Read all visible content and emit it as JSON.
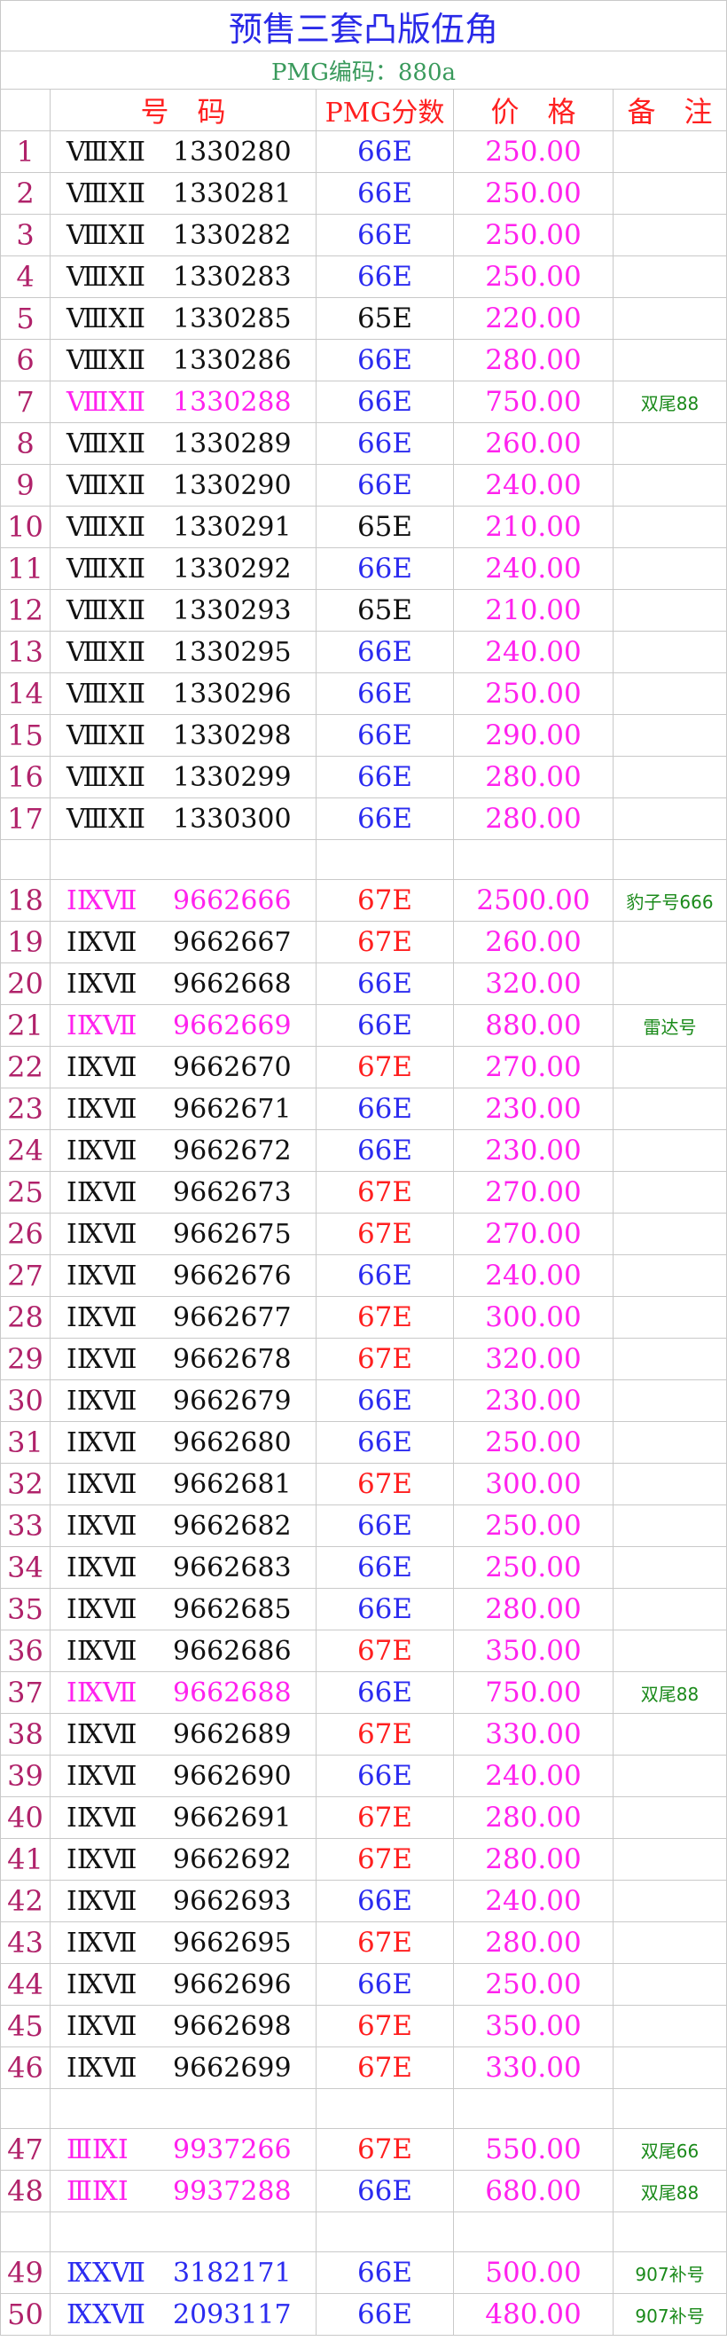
{
  "title": "预售三套凸版伍角",
  "subtitle": "PMG编码：880a",
  "headers": {
    "code": "号　码",
    "grade": "PMG分数",
    "price": "价　格",
    "note": "备　注"
  },
  "colors": {
    "title": "#2a2ae8",
    "subtitle": "#3a9a5c",
    "header": "#ff2020",
    "grade_66": "#2b2bf0",
    "grade_67": "#ff1f1f",
    "grade_65": "#111111",
    "price": "#ff22ee",
    "note": "#1a8a1a",
    "row_number": "#b0226a"
  },
  "rows": [
    {
      "type": "item",
      "no": "1",
      "serial": "ⅧⅩⅡ",
      "number": "1330280",
      "grade": "66E",
      "grade_color": "blue",
      "price": "250.00",
      "note": ""
    },
    {
      "type": "item",
      "no": "2",
      "serial": "ⅧⅩⅡ",
      "number": "1330281",
      "grade": "66E",
      "grade_color": "blue",
      "price": "250.00",
      "note": ""
    },
    {
      "type": "item",
      "no": "3",
      "serial": "ⅧⅩⅡ",
      "number": "1330282",
      "grade": "66E",
      "grade_color": "blue",
      "price": "250.00",
      "note": ""
    },
    {
      "type": "item",
      "no": "4",
      "serial": "ⅧⅩⅡ",
      "number": "1330283",
      "grade": "66E",
      "grade_color": "blue",
      "price": "250.00",
      "note": ""
    },
    {
      "type": "item",
      "no": "5",
      "serial": "ⅧⅩⅡ",
      "number": "1330285",
      "grade": "65E",
      "grade_color": "black",
      "price": "220.00",
      "note": ""
    },
    {
      "type": "item",
      "no": "6",
      "serial": "ⅧⅩⅡ",
      "number": "1330286",
      "grade": "66E",
      "grade_color": "blue",
      "price": "280.00",
      "note": ""
    },
    {
      "type": "item",
      "no": "7",
      "serial": "ⅧⅩⅡ",
      "number": "1330288",
      "grade": "66E",
      "grade_color": "blue",
      "price": "750.00",
      "note": "双尾88",
      "highlight": true
    },
    {
      "type": "item",
      "no": "8",
      "serial": "ⅧⅩⅡ",
      "number": "1330289",
      "grade": "66E",
      "grade_color": "blue",
      "price": "260.00",
      "note": ""
    },
    {
      "type": "item",
      "no": "9",
      "serial": "ⅧⅩⅡ",
      "number": "1330290",
      "grade": "66E",
      "grade_color": "blue",
      "price": "240.00",
      "note": ""
    },
    {
      "type": "item",
      "no": "10",
      "serial": "ⅧⅩⅡ",
      "number": "1330291",
      "grade": "65E",
      "grade_color": "black",
      "price": "210.00",
      "note": ""
    },
    {
      "type": "item",
      "no": "11",
      "serial": "ⅧⅩⅡ",
      "number": "1330292",
      "grade": "66E",
      "grade_color": "blue",
      "price": "240.00",
      "note": ""
    },
    {
      "type": "item",
      "no": "12",
      "serial": "ⅧⅩⅡ",
      "number": "1330293",
      "grade": "65E",
      "grade_color": "black",
      "price": "210.00",
      "note": ""
    },
    {
      "type": "item",
      "no": "13",
      "serial": "ⅧⅩⅡ",
      "number": "1330295",
      "grade": "66E",
      "grade_color": "blue",
      "price": "240.00",
      "note": ""
    },
    {
      "type": "item",
      "no": "14",
      "serial": "ⅧⅩⅡ",
      "number": "1330296",
      "grade": "66E",
      "grade_color": "blue",
      "price": "250.00",
      "note": ""
    },
    {
      "type": "item",
      "no": "15",
      "serial": "ⅧⅩⅡ",
      "number": "1330298",
      "grade": "66E",
      "grade_color": "blue",
      "price": "290.00",
      "note": ""
    },
    {
      "type": "item",
      "no": "16",
      "serial": "ⅧⅩⅡ",
      "number": "1330299",
      "grade": "66E",
      "grade_color": "blue",
      "price": "280.00",
      "note": ""
    },
    {
      "type": "item",
      "no": "17",
      "serial": "ⅧⅩⅡ",
      "number": "1330300",
      "grade": "66E",
      "grade_color": "blue",
      "price": "280.00",
      "note": ""
    },
    {
      "type": "blank"
    },
    {
      "type": "item",
      "no": "18",
      "serial": "ⅠⅨⅦ",
      "number": "9662666",
      "grade": "67E",
      "grade_color": "red",
      "price": "2500.00",
      "note": "豹子号666",
      "highlight": true
    },
    {
      "type": "item",
      "no": "19",
      "serial": "ⅠⅨⅦ",
      "number": "9662667",
      "grade": "67E",
      "grade_color": "red",
      "price": "260.00",
      "note": ""
    },
    {
      "type": "item",
      "no": "20",
      "serial": "ⅠⅨⅦ",
      "number": "9662668",
      "grade": "66E",
      "grade_color": "blue",
      "price": "320.00",
      "note": ""
    },
    {
      "type": "item",
      "no": "21",
      "serial": "ⅠⅨⅦ",
      "number": "9662669",
      "grade": "66E",
      "grade_color": "blue",
      "price": "880.00",
      "note": "雷达号",
      "highlight": true
    },
    {
      "type": "item",
      "no": "22",
      "serial": "ⅠⅨⅦ",
      "number": "9662670",
      "grade": "67E",
      "grade_color": "red",
      "price": "270.00",
      "note": ""
    },
    {
      "type": "item",
      "no": "23",
      "serial": "ⅠⅨⅦ",
      "number": "9662671",
      "grade": "66E",
      "grade_color": "blue",
      "price": "230.00",
      "note": ""
    },
    {
      "type": "item",
      "no": "24",
      "serial": "ⅠⅨⅦ",
      "number": "9662672",
      "grade": "66E",
      "grade_color": "blue",
      "price": "230.00",
      "note": ""
    },
    {
      "type": "item",
      "no": "25",
      "serial": "ⅠⅨⅦ",
      "number": "9662673",
      "grade": "67E",
      "grade_color": "red",
      "price": "270.00",
      "note": ""
    },
    {
      "type": "item",
      "no": "26",
      "serial": "ⅠⅨⅦ",
      "number": "9662675",
      "grade": "67E",
      "grade_color": "red",
      "price": "270.00",
      "note": ""
    },
    {
      "type": "item",
      "no": "27",
      "serial": "ⅠⅨⅦ",
      "number": "9662676",
      "grade": "66E",
      "grade_color": "blue",
      "price": "240.00",
      "note": ""
    },
    {
      "type": "item",
      "no": "28",
      "serial": "ⅠⅨⅦ",
      "number": "9662677",
      "grade": "67E",
      "grade_color": "red",
      "price": "300.00",
      "note": ""
    },
    {
      "type": "item",
      "no": "29",
      "serial": "ⅠⅨⅦ",
      "number": "9662678",
      "grade": "67E",
      "grade_color": "red",
      "price": "320.00",
      "note": ""
    },
    {
      "type": "item",
      "no": "30",
      "serial": "ⅠⅨⅦ",
      "number": "9662679",
      "grade": "66E",
      "grade_color": "blue",
      "price": "230.00",
      "note": ""
    },
    {
      "type": "item",
      "no": "31",
      "serial": "ⅠⅨⅦ",
      "number": "9662680",
      "grade": "66E",
      "grade_color": "blue",
      "price": "250.00",
      "note": ""
    },
    {
      "type": "item",
      "no": "32",
      "serial": "ⅠⅨⅦ",
      "number": "9662681",
      "grade": "67E",
      "grade_color": "red",
      "price": "300.00",
      "note": ""
    },
    {
      "type": "item",
      "no": "33",
      "serial": "ⅠⅨⅦ",
      "number": "9662682",
      "grade": "66E",
      "grade_color": "blue",
      "price": "250.00",
      "note": ""
    },
    {
      "type": "item",
      "no": "34",
      "serial": "ⅠⅨⅦ",
      "number": "9662683",
      "grade": "66E",
      "grade_color": "blue",
      "price": "250.00",
      "note": ""
    },
    {
      "type": "item",
      "no": "35",
      "serial": "ⅠⅨⅦ",
      "number": "9662685",
      "grade": "66E",
      "grade_color": "blue",
      "price": "280.00",
      "note": ""
    },
    {
      "type": "item",
      "no": "36",
      "serial": "ⅠⅨⅦ",
      "number": "9662686",
      "grade": "67E",
      "grade_color": "red",
      "price": "350.00",
      "note": ""
    },
    {
      "type": "item",
      "no": "37",
      "serial": "ⅠⅨⅦ",
      "number": "9662688",
      "grade": "66E",
      "grade_color": "blue",
      "price": "750.00",
      "note": "双尾88",
      "highlight": true
    },
    {
      "type": "item",
      "no": "38",
      "serial": "ⅠⅨⅦ",
      "number": "9662689",
      "grade": "67E",
      "grade_color": "red",
      "price": "330.00",
      "note": ""
    },
    {
      "type": "item",
      "no": "39",
      "serial": "ⅠⅨⅦ",
      "number": "9662690",
      "grade": "66E",
      "grade_color": "blue",
      "price": "240.00",
      "note": ""
    },
    {
      "type": "item",
      "no": "40",
      "serial": "ⅠⅨⅦ",
      "number": "9662691",
      "grade": "67E",
      "grade_color": "red",
      "price": "280.00",
      "note": ""
    },
    {
      "type": "item",
      "no": "41",
      "serial": "ⅠⅨⅦ",
      "number": "9662692",
      "grade": "67E",
      "grade_color": "red",
      "price": "280.00",
      "note": ""
    },
    {
      "type": "item",
      "no": "42",
      "serial": "ⅠⅨⅦ",
      "number": "9662693",
      "grade": "66E",
      "grade_color": "blue",
      "price": "240.00",
      "note": ""
    },
    {
      "type": "item",
      "no": "43",
      "serial": "ⅠⅨⅦ",
      "number": "9662695",
      "grade": "67E",
      "grade_color": "red",
      "price": "280.00",
      "note": ""
    },
    {
      "type": "item",
      "no": "44",
      "serial": "ⅠⅨⅦ",
      "number": "9662696",
      "grade": "66E",
      "grade_color": "blue",
      "price": "250.00",
      "note": ""
    },
    {
      "type": "item",
      "no": "45",
      "serial": "ⅠⅨⅦ",
      "number": "9662698",
      "grade": "67E",
      "grade_color": "red",
      "price": "350.00",
      "note": ""
    },
    {
      "type": "item",
      "no": "46",
      "serial": "ⅠⅨⅦ",
      "number": "9662699",
      "grade": "67E",
      "grade_color": "red",
      "price": "330.00",
      "note": ""
    },
    {
      "type": "blank"
    },
    {
      "type": "item",
      "no": "47",
      "serial": "ⅢⅨⅠ",
      "number": "9937266",
      "grade": "67E",
      "grade_color": "red",
      "price": "550.00",
      "note": "双尾66",
      "highlight": true
    },
    {
      "type": "item",
      "no": "48",
      "serial": "ⅢⅨⅠ",
      "number": "9937288",
      "grade": "66E",
      "grade_color": "blue",
      "price": "680.00",
      "note": "双尾88",
      "highlight": true
    },
    {
      "type": "blank"
    },
    {
      "type": "item",
      "no": "49",
      "serial": "ⅨⅩⅦ",
      "number": "3182171",
      "grade": "66E",
      "grade_color": "blue",
      "price": "500.00",
      "note": "907补号",
      "code_blue": true
    },
    {
      "type": "item",
      "no": "50",
      "serial": "ⅨⅩⅦ",
      "number": "2093117",
      "grade": "66E",
      "grade_color": "blue",
      "price": "480.00",
      "note": "907补号",
      "code_blue": true
    }
  ]
}
